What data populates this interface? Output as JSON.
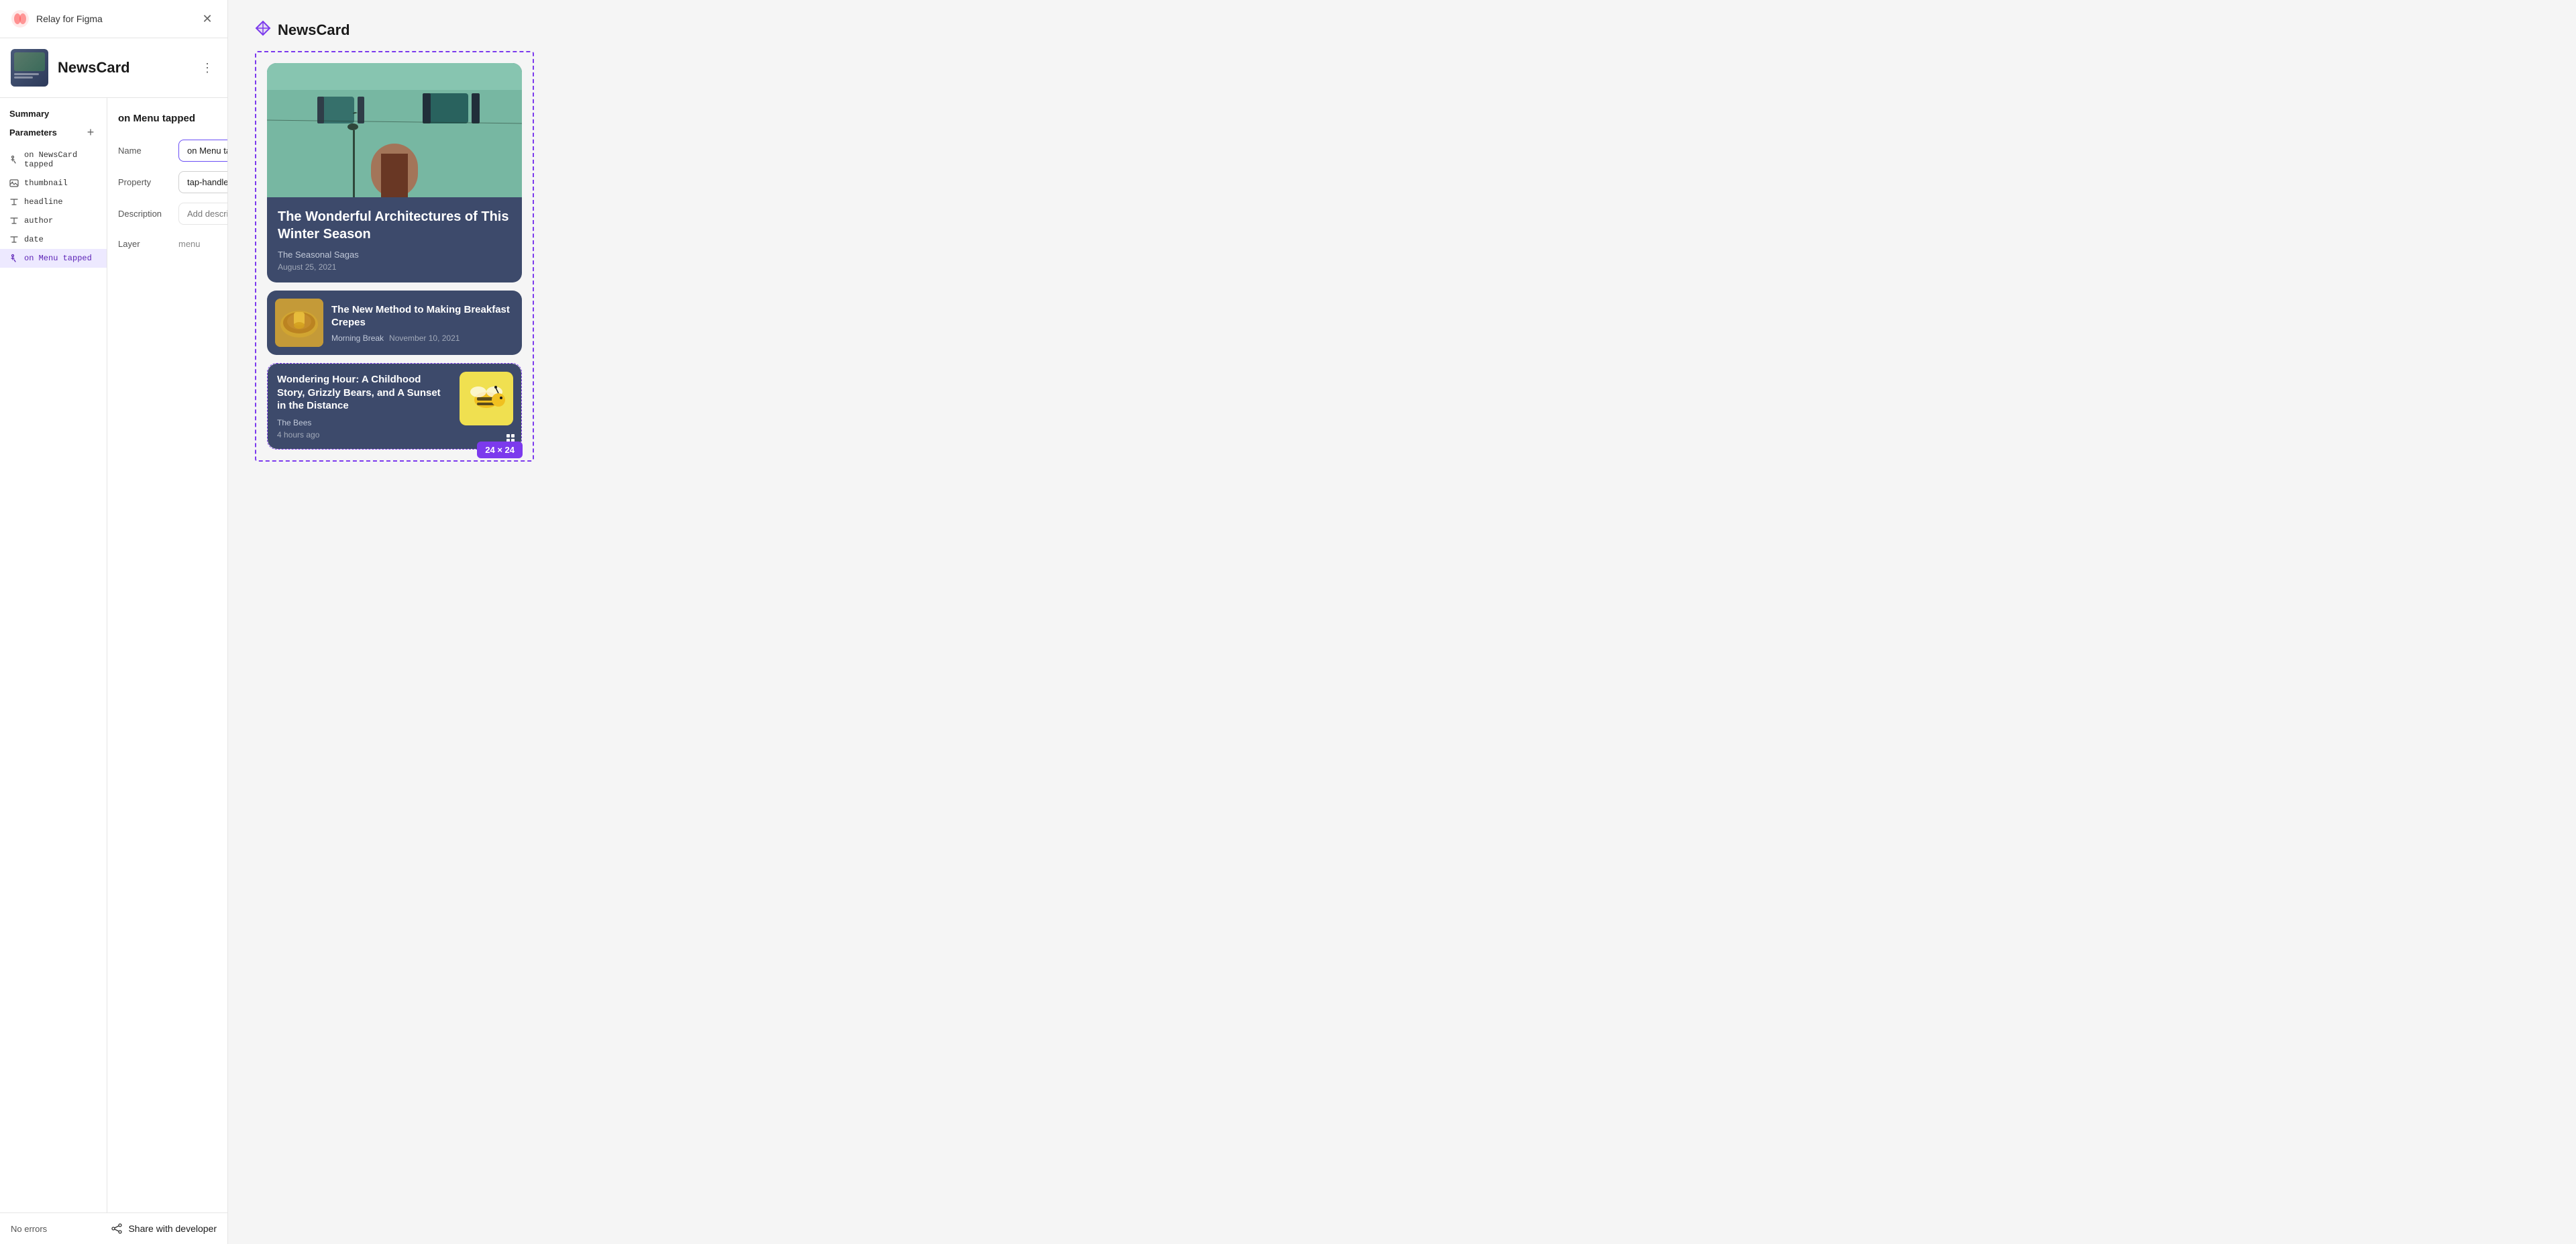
{
  "app": {
    "title": "Relay for Figma",
    "close_label": "×"
  },
  "component": {
    "name": "NewsCard",
    "more_label": "⋮"
  },
  "sidebar": {
    "summary_label": "Summary",
    "parameters_label": "Parameters",
    "add_label": "+",
    "params": [
      {
        "id": "on-newscard-tapped",
        "icon": "tap-icon",
        "label": "on NewsCard tapped",
        "type": "tap"
      },
      {
        "id": "thumbnail",
        "icon": "image-icon",
        "label": "thumbnail",
        "type": "image"
      },
      {
        "id": "headline",
        "icon": "text-icon",
        "label": "headline",
        "type": "text"
      },
      {
        "id": "author",
        "icon": "text-icon",
        "label": "author",
        "type": "text"
      },
      {
        "id": "date",
        "icon": "text-icon",
        "label": "date",
        "type": "text"
      },
      {
        "id": "on-menu-tapped",
        "icon": "tap-icon",
        "label": "on Menu tapped",
        "type": "tap",
        "active": true
      }
    ]
  },
  "detail": {
    "title": "on Menu tapped",
    "delete_label": "🗑",
    "fields": {
      "name_label": "Name",
      "name_value": "on Menu tapped",
      "property_label": "Property",
      "property_value": "tap-handler",
      "description_label": "Description",
      "description_placeholder": "Add description",
      "layer_label": "Layer",
      "layer_value": "menu"
    }
  },
  "footer": {
    "status": "No errors",
    "share_label": "Share with developer"
  },
  "preview": {
    "component_title": "NewsCard",
    "cards": {
      "large": {
        "headline": "The Wonderful Architectures of This Winter Season",
        "author": "The Seasonal Sagas",
        "date": "August 25, 2021"
      },
      "medium": {
        "headline": "The New Method to Making Breakfast Crepes",
        "author": "Morning Break",
        "date": "November 10, 2021"
      },
      "small": {
        "headline": "Wondering Hour: A Childhood Story, Grizzly Bears, and A Sunset in the Distance",
        "author": "The Bees",
        "date": "4 hours ago"
      }
    },
    "size_badge": "24 × 24"
  }
}
